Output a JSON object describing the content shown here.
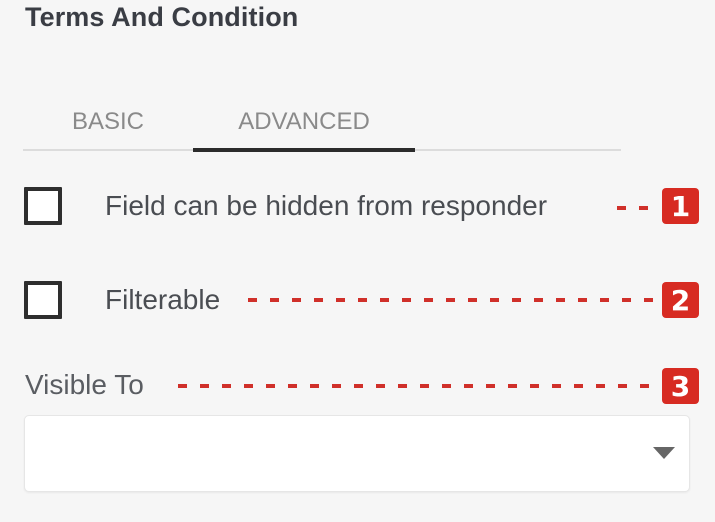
{
  "panel": {
    "title": "Terms And Condition",
    "tabs": [
      {
        "label": "BASIC",
        "active": false
      },
      {
        "label": "ADVANCED",
        "active": true
      }
    ],
    "options": [
      {
        "label": "Field can be hidden from responder",
        "checked": false
      },
      {
        "label": "Filterable",
        "checked": false
      }
    ],
    "visible_to": {
      "label": "Visible To",
      "value": ""
    }
  },
  "annotations": [
    {
      "number": "1",
      "target": "Field can be hidden from responder"
    },
    {
      "number": "2",
      "target": "Filterable"
    },
    {
      "number": "3",
      "target": "Visible To"
    }
  ],
  "colors": {
    "annotation_red": "#d72b22",
    "active_tab_indicator": "#2b2b2b"
  }
}
